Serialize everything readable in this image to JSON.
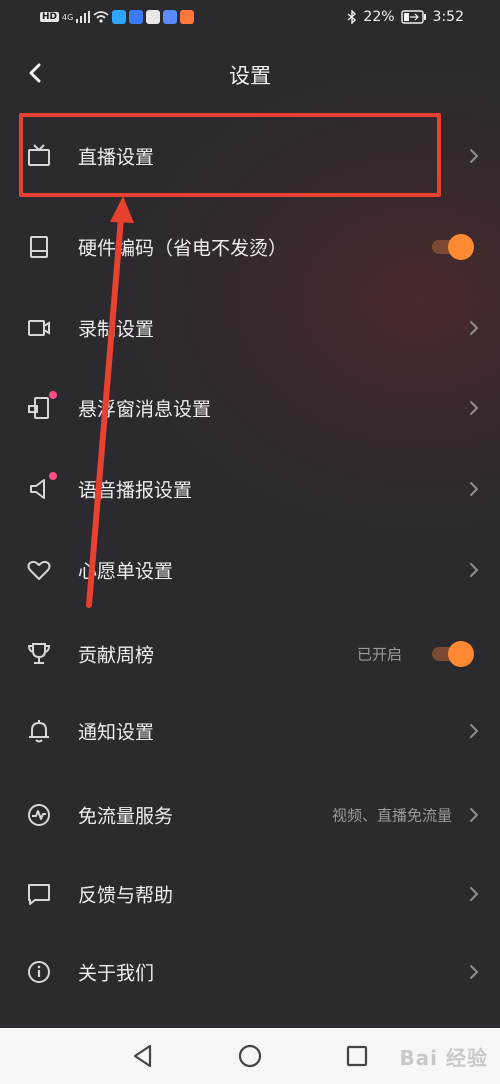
{
  "status_bar": {
    "network_badge": "HD",
    "signal_label": "4G",
    "battery_percent": "22%",
    "time": "3:52",
    "notification_icons": [
      {
        "name": "wechat-icon",
        "color": "#2fa6ff"
      },
      {
        "name": "baidu-icon",
        "color": "#3a7bff"
      },
      {
        "name": "bilibili-icon",
        "color": "#e8e8e8"
      },
      {
        "name": "music-icon",
        "color": "#5a8cff"
      },
      {
        "name": "app-icon",
        "color": "#ff7a3a"
      }
    ]
  },
  "header": {
    "title": "设置",
    "back_icon": "chevron-left-icon"
  },
  "settings": [
    {
      "key": "live",
      "label": "直播设置",
      "icon": "tv-icon",
      "control": "chevron"
    },
    {
      "key": "hw_encoding",
      "label": "硬件编码（省电不发烫）",
      "icon": "device-icon",
      "control": "toggle",
      "toggle_on": true
    },
    {
      "key": "record",
      "label": "录制设置",
      "icon": "video-icon",
      "control": "chevron"
    },
    {
      "key": "floating",
      "label": "悬浮窗消息设置",
      "icon": "floating-window-icon",
      "control": "chevron",
      "dot": true
    },
    {
      "key": "voice",
      "label": "语音播报设置",
      "icon": "speaker-icon",
      "control": "chevron",
      "dot": true
    },
    {
      "key": "wishlist",
      "label": "心愿单设置",
      "icon": "heart-icon",
      "control": "chevron"
    },
    {
      "key": "contribution",
      "label": "贡献周榜",
      "icon": "trophy-icon",
      "control": "toggle",
      "toggle_on": true,
      "value": "已开启"
    },
    {
      "key": "notify",
      "label": "通知设置",
      "icon": "bell-icon",
      "control": "chevron"
    },
    {
      "key": "free_data",
      "label": "免流量服务",
      "icon": "pulse-icon",
      "control": "chevron",
      "value": "视频、直播免流量"
    },
    {
      "key": "feedback",
      "label": "反馈与帮助",
      "icon": "chat-icon",
      "control": "chevron"
    },
    {
      "key": "about",
      "label": "关于我们",
      "icon": "info-icon",
      "control": "chevron"
    }
  ],
  "annotation": {
    "highlight_color": "#e8412f",
    "target": "直播设置"
  },
  "nav_bar": {
    "back_icon": "nav-back-icon",
    "home_icon": "nav-home-icon",
    "recent_icon": "nav-recent-icon"
  },
  "watermark": "Bai 经验",
  "colors": {
    "accent": "#ff8a33",
    "background": "#2b2a2e",
    "dot": "#ff4f80"
  }
}
